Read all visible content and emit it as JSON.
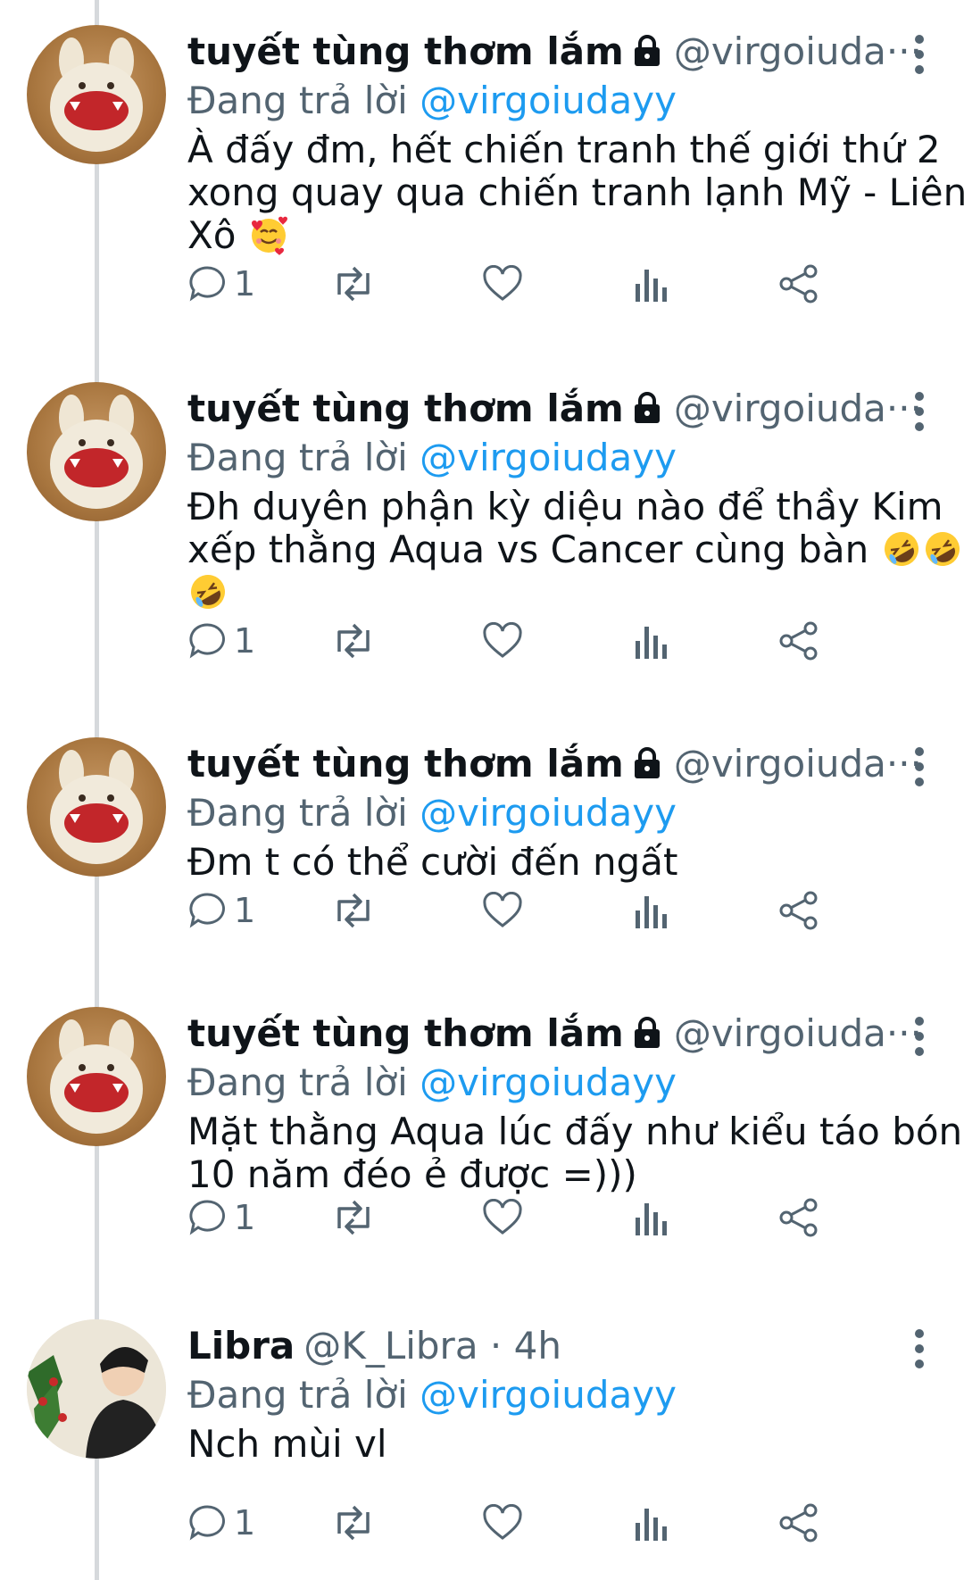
{
  "colors": {
    "text": "#0f1419",
    "secondary": "#536471",
    "link": "#1d9bf0",
    "thread_line": "#d6d9dc",
    "avatar_bg": "#a8763f"
  },
  "tweets": [
    {
      "name": "tuyết tùng thơm lắm",
      "handle": "@virgoiuda···",
      "reply_prefix": "Đang trả lời ",
      "reply_mention": "@virgoiudayy",
      "lines": [
        "À đấy đm, hết chiến tranh thế giới thứ 2",
        "xong quay qua chiến tranh lạnh Mỹ - Liên",
        "Xô"
      ],
      "emoji": [
        "smiling-face-with-hearts"
      ],
      "reply_count": "1",
      "avatar_icon": "bunny-plush-avatar-icon"
    },
    {
      "name": "tuyết tùng thơm lắm",
      "handle": "@virgoiuda···",
      "reply_prefix": "Đang trả lời ",
      "reply_mention": "@virgoiudayy",
      "lines": [
        "Đh duyên phận kỳ diệu nào để thầy Kim",
        "xếp thằng Aqua vs Cancer cùng bàn"
      ],
      "emoji": [
        "rolling-on-floor-laughing",
        "rolling-on-floor-laughing",
        "rolling-on-floor-laughing"
      ],
      "reply_count": "1",
      "avatar_icon": "bunny-plush-avatar-icon"
    },
    {
      "name": "tuyết tùng thơm lắm",
      "handle": "@virgoiuda···",
      "reply_prefix": "Đang trả lời ",
      "reply_mention": "@virgoiudayy",
      "lines": [
        "Đm t có thể cười đến ngất"
      ],
      "emoji": [],
      "reply_count": "1",
      "avatar_icon": "bunny-plush-avatar-icon"
    },
    {
      "name": "tuyết tùng thơm lắm",
      "handle": "@virgoiuda···",
      "reply_prefix": "Đang trả lời ",
      "reply_mention": "@virgoiudayy",
      "lines": [
        "Mặt thằng Aqua lúc đấy như kiểu táo bón",
        "10 năm đéo ẻ được =)))"
      ],
      "emoji": [],
      "reply_count": "1",
      "avatar_icon": "bunny-plush-avatar-icon"
    },
    {
      "name": "Libra",
      "handle": "@K_Libra · 4h",
      "reply_prefix": "Đang trả lời ",
      "reply_mention": "@virgoiudayy",
      "lines": [
        "Nch mùi vl"
      ],
      "emoji": [],
      "reply_count": "1",
      "avatar_icon": "person-portrait-avatar-icon"
    }
  ]
}
